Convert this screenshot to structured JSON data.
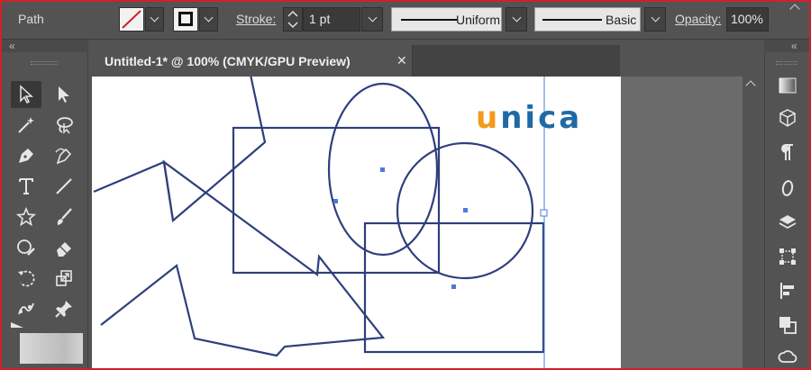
{
  "control_bar": {
    "selection_type": "Path",
    "fill_swatch": "none-slash",
    "stroke_label": "Stroke:",
    "stroke_weight": "1 pt",
    "variable_width_profile": "Uniform",
    "brush_definition": "Basic",
    "opacity_label": "Opacity:",
    "opacity_value": "100%"
  },
  "document_tab": {
    "title": "Untitled-1* @ 100% (CMYK/GPU Preview)",
    "close_icon": "close-icon"
  },
  "tools": [
    {
      "name": "selection-tool-icon",
      "selected": true
    },
    {
      "name": "direct-selection-tool-icon"
    },
    {
      "name": "magic-wand-tool-icon"
    },
    {
      "name": "lasso-tool-icon"
    },
    {
      "name": "pen-tool-icon"
    },
    {
      "name": "curvature-tool-icon"
    },
    {
      "name": "type-tool-icon"
    },
    {
      "name": "line-segment-tool-icon"
    },
    {
      "name": "star-tool-icon"
    },
    {
      "name": "paintbrush-tool-icon"
    },
    {
      "name": "shaper-tool-icon"
    },
    {
      "name": "eraser-tool-icon"
    },
    {
      "name": "rotate-tool-icon"
    },
    {
      "name": "scale-tool-icon"
    },
    {
      "name": "puppet-warp-tool-icon"
    },
    {
      "name": "pin-icon"
    }
  ],
  "right_panels": [
    "gradient-panel-icon",
    "3d-materials-icon",
    "paragraph-icon",
    "character-glyph-icon",
    "layers-icon",
    "transform-icon",
    "align-icon",
    "pathfinder-icon",
    "creative-cloud-libraries-icon"
  ],
  "artwork": {
    "logo_text": {
      "u": "u",
      "rest": "nica"
    },
    "stroke_color": "#2e3f7c",
    "accent_color": "#f39a1e",
    "logo_color": "#1f6aa6",
    "selection_color": "#4a7bdc"
  }
}
